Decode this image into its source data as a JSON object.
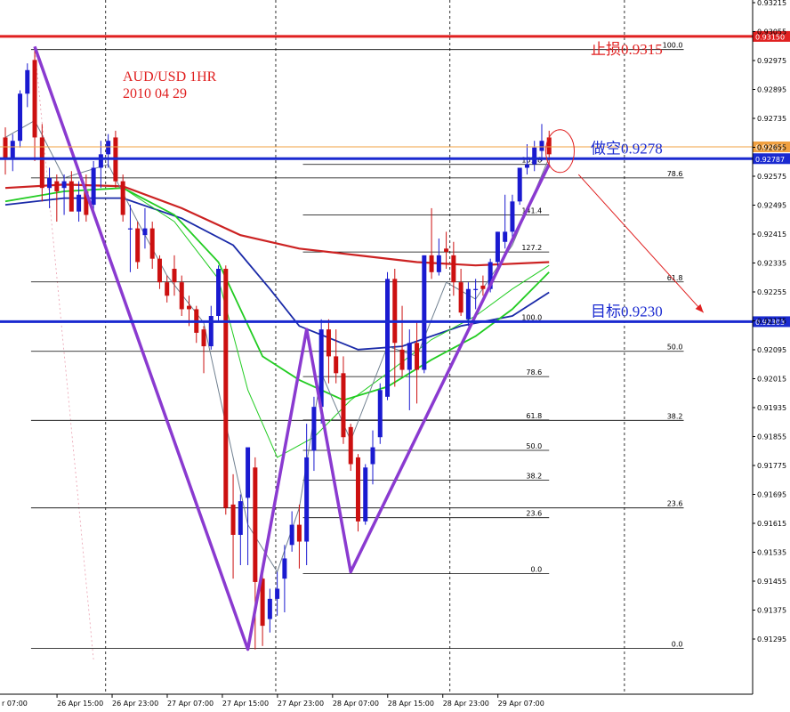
{
  "chart_data": {
    "type": "candlestick",
    "title": "AUD/USD 1HR",
    "subtitle": "2010 04 29",
    "ylim": [
      0.91255,
      0.932
    ],
    "xlim": [
      0,
      137
    ],
    "y_ticks": [
      "0.93215",
      "0.93055",
      "0.92975",
      "0.92895",
      "0.92735",
      "0.92655",
      "0.92575",
      "0.92495",
      "0.92415",
      "0.92335",
      "0.92255",
      "0.92175",
      "0.92095",
      "0.92015",
      "0.91935",
      "0.91855",
      "0.91775",
      "0.91695",
      "0.91615",
      "0.91535",
      "0.91455",
      "0.91375",
      "0.91295"
    ],
    "x_ticks": [
      {
        "label": "r 07:00",
        "x": 0
      },
      {
        "label": "26 Apr 15:00",
        "x": 16
      },
      {
        "label": "26 Apr 23:00",
        "x": 31
      },
      {
        "label": "27 Apr 07:00",
        "x": 46
      },
      {
        "label": "27 Apr 15:00",
        "x": 61
      },
      {
        "label": "27 Apr 23:00",
        "x": 76
      },
      {
        "label": "28 Apr 07:00",
        "x": 91
      },
      {
        "label": "28 Apr 15:00",
        "x": 106
      },
      {
        "label": "28 Apr 23:00",
        "x": 121
      },
      {
        "label": "29 Apr 07:00",
        "x": 136
      }
    ],
    "vertical_separators_x": [
      27.3,
      73.6,
      121,
      168.5
    ],
    "candles": [
      {
        "x": 0,
        "o": 0.9285,
        "h": 0.9288,
        "l": 0.9274,
        "c": 0.9279
      },
      {
        "x": 2,
        "o": 0.9279,
        "h": 0.9286,
        "l": 0.9275,
        "c": 0.9284
      },
      {
        "x": 4,
        "o": 0.9284,
        "h": 0.9299,
        "l": 0.9282,
        "c": 0.9298
      },
      {
        "x": 6,
        "o": 0.9298,
        "h": 0.9307,
        "l": 0.9294,
        "c": 0.9305
      },
      {
        "x": 8,
        "o": 0.9308,
        "h": 0.9311,
        "l": 0.9278,
        "c": 0.9285
      },
      {
        "x": 10,
        "o": 0.9285,
        "h": 0.9289,
        "l": 0.9266,
        "c": 0.927
      },
      {
        "x": 12,
        "o": 0.927,
        "h": 0.9276,
        "l": 0.9264,
        "c": 0.9273
      },
      {
        "x": 14,
        "o": 0.9272,
        "h": 0.9274,
        "l": 0.926,
        "c": 0.9269
      },
      {
        "x": 16,
        "o": 0.927,
        "h": 0.9274,
        "l": 0.9262,
        "c": 0.9272
      },
      {
        "x": 18,
        "o": 0.9272,
        "h": 0.9275,
        "l": 0.9264,
        "c": 0.9263
      },
      {
        "x": 20,
        "o": 0.9263,
        "h": 0.9272,
        "l": 0.926,
        "c": 0.9268
      },
      {
        "x": 22,
        "o": 0.9269,
        "h": 0.9274,
        "l": 0.926,
        "c": 0.9262
      },
      {
        "x": 24,
        "o": 0.9265,
        "h": 0.9278,
        "l": 0.9262,
        "c": 0.9276
      },
      {
        "x": 26,
        "o": 0.9276,
        "h": 0.9284,
        "l": 0.927,
        "c": 0.928
      },
      {
        "x": 28,
        "o": 0.928,
        "h": 0.9286,
        "l": 0.9276,
        "c": 0.9284
      },
      {
        "x": 30,
        "o": 0.9285,
        "h": 0.9287,
        "l": 0.927,
        "c": 0.9272
      },
      {
        "x": 32,
        "o": 0.9272,
        "h": 0.9274,
        "l": 0.926,
        "c": 0.9262
      },
      {
        "x": 34,
        "o": 0.9258,
        "h": 0.9265,
        "l": 0.9245,
        "c": 0.9258
      },
      {
        "x": 36,
        "o": 0.9258,
        "h": 0.926,
        "l": 0.9246,
        "c": 0.9248
      },
      {
        "x": 38,
        "o": 0.9256,
        "h": 0.9264,
        "l": 0.9252,
        "c": 0.9258
      },
      {
        "x": 40,
        "o": 0.9258,
        "h": 0.926,
        "l": 0.9246,
        "c": 0.9249
      },
      {
        "x": 42,
        "o": 0.9249,
        "h": 0.925,
        "l": 0.924,
        "c": 0.9242
      },
      {
        "x": 44,
        "o": 0.9242,
        "h": 0.9244,
        "l": 0.9236,
        "c": 0.9238
      },
      {
        "x": 46,
        "o": 0.9246,
        "h": 0.925,
        "l": 0.9238,
        "c": 0.9242
      },
      {
        "x": 48,
        "o": 0.9242,
        "h": 0.9244,
        "l": 0.9232,
        "c": 0.9234
      },
      {
        "x": 50,
        "o": 0.9235,
        "h": 0.9238,
        "l": 0.9229,
        "c": 0.9234
      },
      {
        "x": 52,
        "o": 0.9234,
        "h": 0.9235,
        "l": 0.9224,
        "c": 0.9227
      },
      {
        "x": 54,
        "o": 0.9228,
        "h": 0.9229,
        "l": 0.9215,
        "c": 0.9223
      },
      {
        "x": 56,
        "o": 0.9223,
        "h": 0.9235,
        "l": 0.9222,
        "c": 0.9232
      },
      {
        "x": 58,
        "o": 0.9232,
        "h": 0.9247,
        "l": 0.923,
        "c": 0.9246
      },
      {
        "x": 60,
        "o": 0.9246,
        "h": 0.9247,
        "l": 0.9173,
        "c": 0.9175
      },
      {
        "x": 62,
        "o": 0.9176,
        "h": 0.9185,
        "l": 0.9154,
        "c": 0.9167
      },
      {
        "x": 64,
        "o": 0.9167,
        "h": 0.9179,
        "l": 0.9158,
        "c": 0.9177
      },
      {
        "x": 66,
        "o": 0.9178,
        "h": 0.9192,
        "l": 0.9158,
        "c": 0.9193
      },
      {
        "x": 68,
        "o": 0.9187,
        "h": 0.919,
        "l": 0.9133,
        "c": 0.9153
      },
      {
        "x": 70,
        "o": 0.9154,
        "h": 0.9156,
        "l": 0.9134,
        "c": 0.914
      },
      {
        "x": 72,
        "o": 0.9142,
        "h": 0.9151,
        "l": 0.9138,
        "c": 0.9148
      },
      {
        "x": 74,
        "o": 0.9148,
        "h": 0.9156,
        "l": 0.9143,
        "c": 0.9151
      },
      {
        "x": 76,
        "o": 0.9154,
        "h": 0.9164,
        "l": 0.9144,
        "c": 0.916
      },
      {
        "x": 78,
        "o": 0.9164,
        "h": 0.9174,
        "l": 0.9162,
        "c": 0.917
      },
      {
        "x": 80,
        "o": 0.917,
        "h": 0.9176,
        "l": 0.9157,
        "c": 0.9165
      },
      {
        "x": 82,
        "o": 0.9165,
        "h": 0.92,
        "l": 0.9158,
        "c": 0.919
      },
      {
        "x": 84,
        "o": 0.9192,
        "h": 0.9208,
        "l": 0.9186,
        "c": 0.9205
      },
      {
        "x": 86,
        "o": 0.9205,
        "h": 0.9231,
        "l": 0.92,
        "c": 0.9228
      },
      {
        "x": 88,
        "o": 0.9228,
        "h": 0.9231,
        "l": 0.9212,
        "c": 0.922
      },
      {
        "x": 90,
        "o": 0.922,
        "h": 0.9228,
        "l": 0.9212,
        "c": 0.9215
      },
      {
        "x": 92,
        "o": 0.9215,
        "h": 0.922,
        "l": 0.9194,
        "c": 0.9196
      },
      {
        "x": 94,
        "o": 0.9199,
        "h": 0.92,
        "l": 0.9186,
        "c": 0.9188
      },
      {
        "x": 96,
        "o": 0.919,
        "h": 0.9191,
        "l": 0.9168,
        "c": 0.9171
      },
      {
        "x": 98,
        "o": 0.9171,
        "h": 0.9188,
        "l": 0.917,
        "c": 0.9187
      },
      {
        "x": 100,
        "o": 0.9188,
        "h": 0.9198,
        "l": 0.9182,
        "c": 0.9193
      },
      {
        "x": 102,
        "o": 0.9196,
        "h": 0.9212,
        "l": 0.9194,
        "c": 0.921
      },
      {
        "x": 104,
        "o": 0.9208,
        "h": 0.9245,
        "l": 0.9207,
        "c": 0.9243
      },
      {
        "x": 106,
        "o": 0.9243,
        "h": 0.9246,
        "l": 0.9211,
        "c": 0.9224
      },
      {
        "x": 108,
        "o": 0.9222,
        "h": 0.9235,
        "l": 0.9214,
        "c": 0.9216
      },
      {
        "x": 110,
        "o": 0.9216,
        "h": 0.9228,
        "l": 0.9204,
        "c": 0.9224
      },
      {
        "x": 112,
        "o": 0.9224,
        "h": 0.923,
        "l": 0.9206,
        "c": 0.9216
      },
      {
        "x": 114,
        "o": 0.9216,
        "h": 0.925,
        "l": 0.9215,
        "c": 0.925
      },
      {
        "x": 116,
        "o": 0.925,
        "h": 0.9264,
        "l": 0.9243,
        "c": 0.9245
      },
      {
        "x": 118,
        "o": 0.9245,
        "h": 0.9255,
        "l": 0.9244,
        "c": 0.925
      },
      {
        "x": 120,
        "o": 0.9252,
        "h": 0.9257,
        "l": 0.9246,
        "c": 0.9251
      },
      {
        "x": 122,
        "o": 0.925,
        "h": 0.9254,
        "l": 0.9238,
        "c": 0.9242
      },
      {
        "x": 124,
        "o": 0.9242,
        "h": 0.9246,
        "l": 0.9232,
        "c": 0.9233
      },
      {
        "x": 126,
        "o": 0.9231,
        "h": 0.9242,
        "l": 0.9229,
        "c": 0.924
      },
      {
        "x": 128,
        "o": 0.924,
        "h": 0.9243,
        "l": 0.9234,
        "c": 0.924
      },
      {
        "x": 130,
        "o": 0.9241,
        "h": 0.9244,
        "l": 0.9238,
        "c": 0.924
      },
      {
        "x": 132,
        "o": 0.924,
        "h": 0.9249,
        "l": 0.9239,
        "c": 0.9248
      },
      {
        "x": 134,
        "o": 0.9248,
        "h": 0.9257,
        "l": 0.9245,
        "c": 0.9257
      },
      {
        "x": 136,
        "o": 0.9254,
        "h": 0.9268,
        "l": 0.9252,
        "c": 0.9257
      },
      {
        "x": 138,
        "o": 0.9257,
        "h": 0.9268,
        "l": 0.9255,
        "c": 0.9266
      },
      {
        "x": 140,
        "o": 0.9266,
        "h": 0.9276,
        "l": 0.9265,
        "c": 0.9276
      },
      {
        "x": 142,
        "o": 0.9276,
        "h": 0.9283,
        "l": 0.9274,
        "c": 0.9277
      },
      {
        "x": 144,
        "o": 0.9277,
        "h": 0.9284,
        "l": 0.9275,
        "c": 0.9282
      },
      {
        "x": 146,
        "o": 0.9281,
        "h": 0.9289,
        "l": 0.9278,
        "c": 0.9284
      },
      {
        "x": 148,
        "o": 0.9285,
        "h": 0.9287,
        "l": 0.9276,
        "c": 0.928
      }
    ],
    "moving_averages": [
      {
        "color": "#cc2222",
        "width": 2.2,
        "points": [
          [
            0,
            0.927
          ],
          [
            16,
            0.9271
          ],
          [
            32,
            0.92705
          ],
          [
            48,
            0.9264
          ],
          [
            64,
            0.9256
          ],
          [
            80,
            0.9252
          ],
          [
            96,
            0.925
          ],
          [
            112,
            0.9248
          ],
          [
            128,
            0.9247
          ],
          [
            148,
            0.9248
          ]
        ]
      },
      {
        "color": "#1a2aa8",
        "width": 1.8,
        "points": [
          [
            0,
            0.9265
          ],
          [
            16,
            0.9267
          ],
          [
            32,
            0.9267
          ],
          [
            48,
            0.9261
          ],
          [
            62,
            0.9253
          ],
          [
            72,
            0.924
          ],
          [
            80,
            0.9229
          ],
          [
            96,
            0.9222
          ],
          [
            108,
            0.9223
          ],
          [
            124,
            0.9229
          ],
          [
            138,
            0.9232
          ],
          [
            148,
            0.9239
          ]
        ]
      },
      {
        "color": "#22cc22",
        "width": 1.8,
        "points": [
          [
            0,
            0.9266
          ],
          [
            16,
            0.9269
          ],
          [
            32,
            0.927
          ],
          [
            46,
            0.9262
          ],
          [
            58,
            0.9248
          ],
          [
            70,
            0.922
          ],
          [
            80,
            0.9213
          ],
          [
            92,
            0.9207
          ],
          [
            104,
            0.9211
          ],
          [
            116,
            0.9219
          ],
          [
            128,
            0.9226
          ],
          [
            138,
            0.9234
          ],
          [
            148,
            0.9245
          ]
        ]
      },
      {
        "color": "#22cc22",
        "width": 1.0,
        "points": [
          [
            0,
            0.9266
          ],
          [
            16,
            0.9269
          ],
          [
            32,
            0.927
          ],
          [
            46,
            0.926
          ],
          [
            58,
            0.9243
          ],
          [
            66,
            0.921
          ],
          [
            74,
            0.919
          ],
          [
            84,
            0.9196
          ],
          [
            94,
            0.9207
          ],
          [
            104,
            0.9215
          ],
          [
            116,
            0.9225
          ],
          [
            128,
            0.9232
          ],
          [
            138,
            0.924
          ],
          [
            148,
            0.9247
          ]
        ]
      },
      {
        "color": "#708090",
        "width": 1.0,
        "points": [
          [
            0,
            0.9285
          ],
          [
            8,
            0.929
          ],
          [
            16,
            0.9273
          ],
          [
            28,
            0.9277
          ],
          [
            36,
            0.926
          ],
          [
            44,
            0.9244
          ],
          [
            54,
            0.923
          ],
          [
            60,
            0.92
          ],
          [
            66,
            0.917
          ],
          [
            74,
            0.9156
          ],
          [
            80,
            0.9175
          ],
          [
            86,
            0.9215
          ],
          [
            94,
            0.9195
          ],
          [
            104,
            0.9223
          ],
          [
            112,
            0.922
          ],
          [
            120,
            0.9242
          ],
          [
            128,
            0.9237
          ],
          [
            138,
            0.9253
          ],
          [
            148,
            0.9279
          ]
        ]
      }
    ],
    "fib_upper": {
      "x_label": 148,
      "levels": [
        {
          "label": "161.8",
          "y": 0.9277
        },
        {
          "label": "141.4",
          "y": 0.9262
        },
        {
          "label": "127.2",
          "y": 0.9251
        },
        {
          "label": "100.0",
          "y": 0.92303
        },
        {
          "label": "78.6",
          "y": 0.9214
        },
        {
          "label": "61.8",
          "y": 0.92011
        },
        {
          "label": "50.0",
          "y": 0.91921
        },
        {
          "label": "38.2",
          "y": 0.91832
        },
        {
          "label": "23.6",
          "y": 0.91721
        },
        {
          "label": "0.0",
          "y": 0.91555
        }
      ]
    },
    "fib_big": {
      "x_label": 181,
      "levels": [
        {
          "label": "100.0",
          "y": 0.93111
        },
        {
          "label": "78.6",
          "y": 0.9273
        },
        {
          "label": "61.8",
          "y": 0.92421
        },
        {
          "label": "50.0",
          "y": 0.92215
        },
        {
          "label": "38.2",
          "y": 0.9201
        },
        {
          "label": "23.6",
          "y": 0.9175
        },
        {
          "label": "0.0",
          "y": 0.91333
        }
      ]
    },
    "zigzag": [
      [
        8,
        0.9312
      ],
      [
        66,
        0.9133
      ],
      [
        82,
        0.9228
      ],
      [
        94,
        0.9156
      ],
      [
        148,
        0.9277
      ]
    ],
    "levels": [
      {
        "value": "0.93150",
        "y": 0.9315,
        "color": "#e02020",
        "annotation": "止损0.9315"
      },
      {
        "value": "0.92822",
        "y": 0.92822,
        "color": "#f0a040",
        "annotation": ""
      },
      {
        "value": "0.92787",
        "y": 0.92787,
        "color": "#1a2ad0",
        "annotation": "做空0.9278"
      },
      {
        "value": "0.92303",
        "y": 0.92303,
        "color": "#1a2ad0",
        "annotation": "目标0.9230"
      }
    ],
    "arrow": {
      "from": [
        156,
        0.9274
      ],
      "to": [
        190,
        0.9233
      ]
    },
    "ellipse_center": [
      150,
      0.9282
    ]
  }
}
